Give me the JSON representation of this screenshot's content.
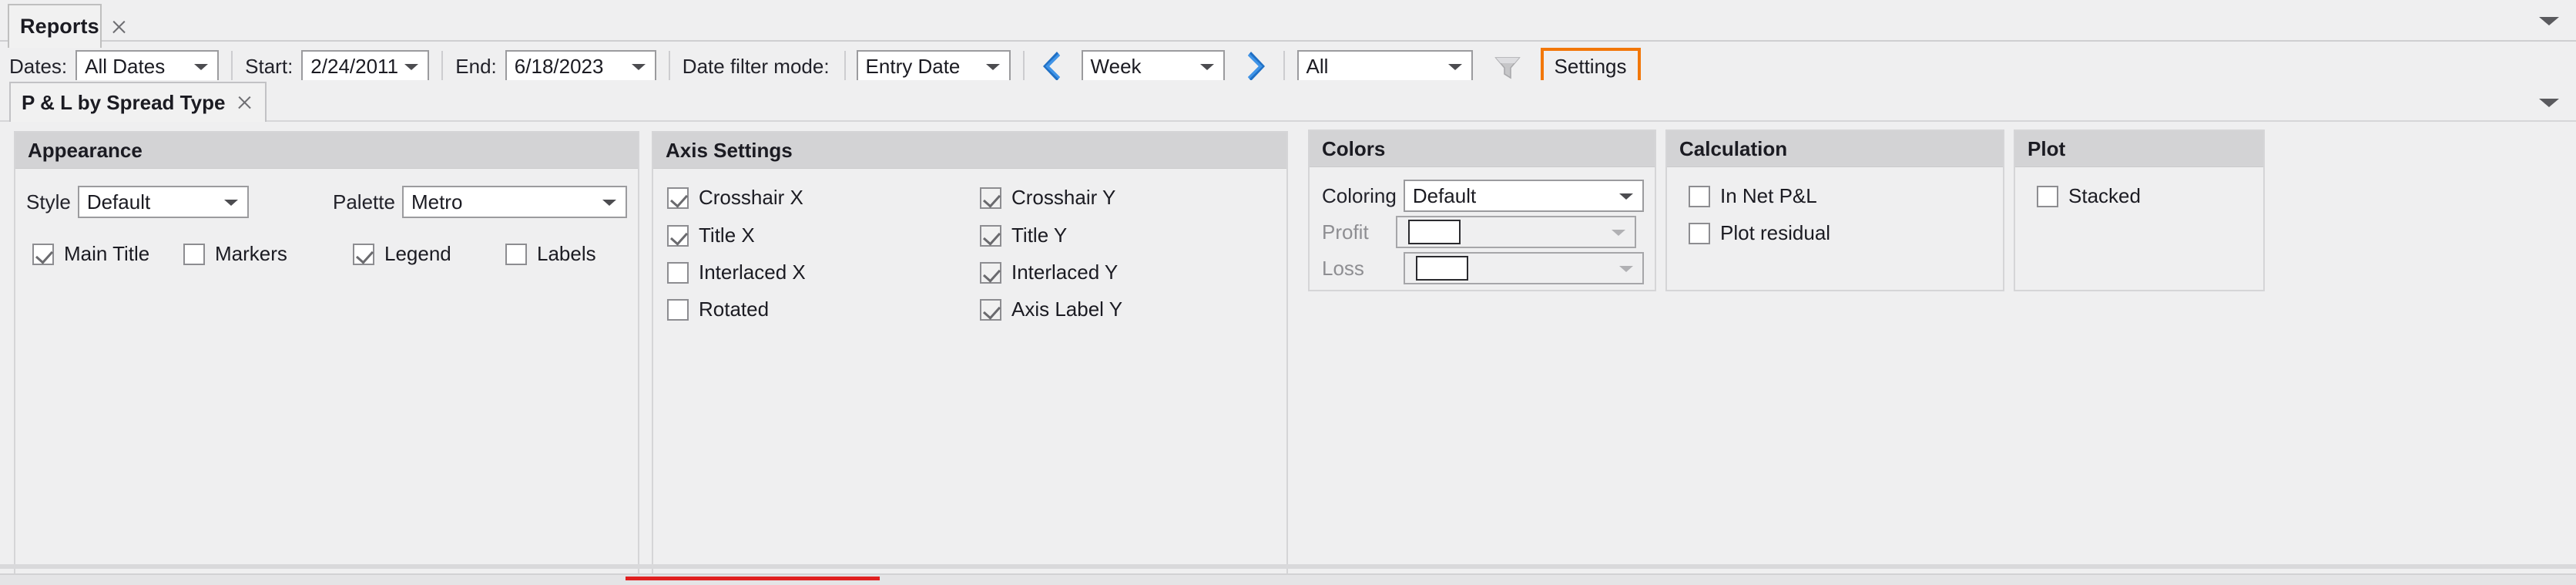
{
  "window": {
    "tabs": [
      {
        "label": "Reports",
        "close_icon": "close-icon"
      }
    ],
    "overflow_caret": "chevron-down-icon"
  },
  "toolbar": {
    "dates_label": "Dates:",
    "dates_value": "All Dates",
    "start_label": "Start:",
    "start_value": "2/24/2011",
    "end_label": "End:",
    "end_value": "6/18/2023",
    "date_filter_mode_label": "Date filter mode:",
    "date_filter_mode_value": "Entry Date",
    "prev_icon": "chevron-left-icon",
    "period_value": "Week",
    "next_icon": "chevron-right-icon",
    "scope_value": "All",
    "filter_icon": "funnel-icon",
    "settings_label": "Settings",
    "settings_highlight_color": "#f2770a"
  },
  "document_tabs": [
    {
      "label": "P & L by Spread Type",
      "close_icon": "close-icon"
    }
  ],
  "panels": {
    "appearance": {
      "title": "Appearance",
      "style_label": "Style",
      "style_value": "Default",
      "palette_label": "Palette",
      "palette_value": "Metro",
      "checkboxes": [
        {
          "label": "Main Title",
          "checked": true
        },
        {
          "label": "Markers",
          "checked": false
        },
        {
          "label": "Legend",
          "checked": true
        },
        {
          "label": "Labels",
          "checked": false
        }
      ]
    },
    "axis_settings": {
      "title": "Axis Settings",
      "left_checkboxes": [
        {
          "label": "Crosshair X",
          "checked": true
        },
        {
          "label": "Title X",
          "checked": true
        },
        {
          "label": "Interlaced X",
          "checked": false
        },
        {
          "label": "Rotated",
          "checked": false
        }
      ],
      "right_checkboxes": [
        {
          "label": "Crosshair Y",
          "checked": true
        },
        {
          "label": "Title Y",
          "checked": true
        },
        {
          "label": "Interlaced Y",
          "checked": true
        },
        {
          "label": "Axis Label Y",
          "checked": true
        }
      ]
    },
    "colors": {
      "title": "Colors",
      "coloring_label": "Coloring",
      "coloring_value": "Default",
      "profit_label": "Profit",
      "profit_swatch": "#ffffff",
      "loss_label": "Loss",
      "loss_swatch": "#ffffff"
    },
    "calculation": {
      "title": "Calculation",
      "checkboxes": [
        {
          "label": "In Net P&L",
          "checked": false
        },
        {
          "label": "Plot residual",
          "checked": false
        }
      ]
    },
    "plot": {
      "title": "Plot",
      "checkboxes": [
        {
          "label": "Stacked",
          "checked": false
        }
      ]
    }
  },
  "status": {
    "progress_color": "#e02020"
  }
}
